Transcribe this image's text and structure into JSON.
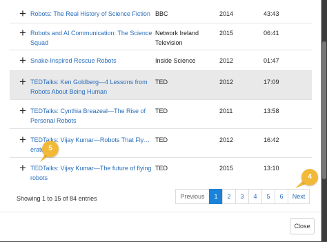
{
  "table": {
    "rows": [
      {
        "title": "Robots: The Real History of Science Fiction",
        "producer": "BBC",
        "year": "2014",
        "duration": "43:43"
      },
      {
        "title": "Robots and AI Communication: The Science Squad",
        "producer": "Network Ireland Television",
        "year": "2015",
        "duration": "06:41"
      },
      {
        "title": "Snake-Inspired Rescue Robots",
        "producer": "Inside Science",
        "year": "2012",
        "duration": "01:47"
      },
      {
        "title": "TEDTalks: Ken Goldberg—4 Lessons from Robots About Being Human",
        "producer": "TED",
        "year": "2012",
        "duration": "17:09"
      },
      {
        "title": "TEDTalks: Cynthia Breazeal—The Rise of Personal Robots",
        "producer": "TED",
        "year": "2011",
        "duration": "13:58"
      },
      {
        "title": "TEDTalks: Vijay Kumar—Robots That Fly… erate",
        "producer": "TED",
        "year": "2012",
        "duration": "16:42"
      },
      {
        "title": "TEDTalks: Vijay Kumar—The future of flying robots",
        "producer": "TED",
        "year": "2015",
        "duration": "13:10"
      }
    ],
    "expand_glyph": "+"
  },
  "info_text": "Showing 1 to 15 of 84 entries",
  "pagination": {
    "previous": "Previous",
    "pages": [
      "1",
      "2",
      "3",
      "4",
      "5",
      "6"
    ],
    "next": "Next"
  },
  "close_label": "Close",
  "callouts": {
    "c5": "5",
    "c4": "4"
  },
  "colors": {
    "link": "#2a6ebb",
    "active_page": "#1a82d8",
    "callout": "#f2b838"
  },
  "icons": {
    "expand": "plus-icon"
  }
}
